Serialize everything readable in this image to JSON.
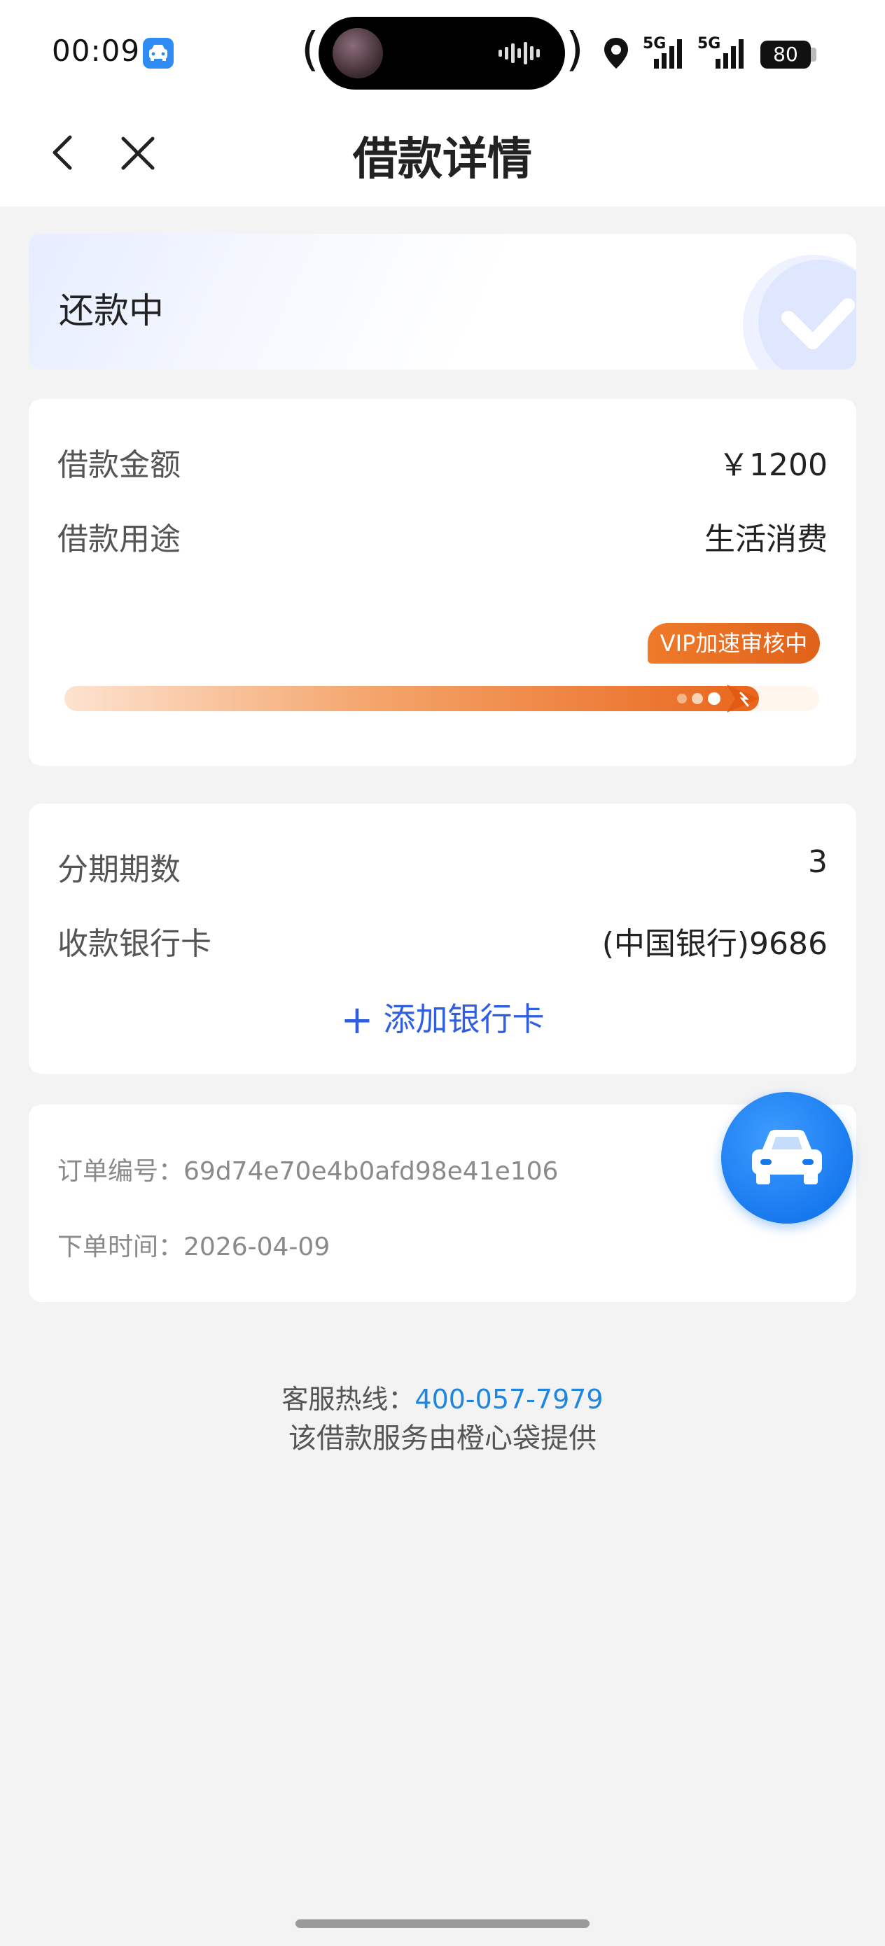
{
  "status_bar": {
    "time": "00:09",
    "battery": "80",
    "net1": "5G",
    "net2": "5G"
  },
  "nav": {
    "title": "借款详情",
    "back_icon": "chevron-left-icon",
    "close_icon": "close-icon"
  },
  "loan_status": {
    "text": "还款中",
    "icon": "check-circle-icon"
  },
  "loan_info": {
    "amount_label": "借款金额",
    "amount_value": "￥1200",
    "purpose_label": "借款用途",
    "purpose_value": "生活消费",
    "progress_badge": "VIP加速审核中",
    "progress_fraction": 0.92
  },
  "repay_info": {
    "installments_label": "分期期数",
    "installments_value": "3",
    "bank_label": "收款银行卡",
    "bank_value": "(中国银行)9686",
    "add_card": "添加银行卡"
  },
  "order": {
    "number_label": "订单编号：",
    "number_value": "69d74e70e4b0afd98e41e106",
    "time_label": "下单时间：",
    "time_value": "2026-04-09"
  },
  "footer": {
    "hotline_label": "客服热线：",
    "hotline_number": "400-057-7979",
    "provider": "该借款服务由橙心袋提供"
  },
  "colors": {
    "accent": "#2f5fe0",
    "progress": "#e9661c",
    "fab": "#1677ee"
  }
}
